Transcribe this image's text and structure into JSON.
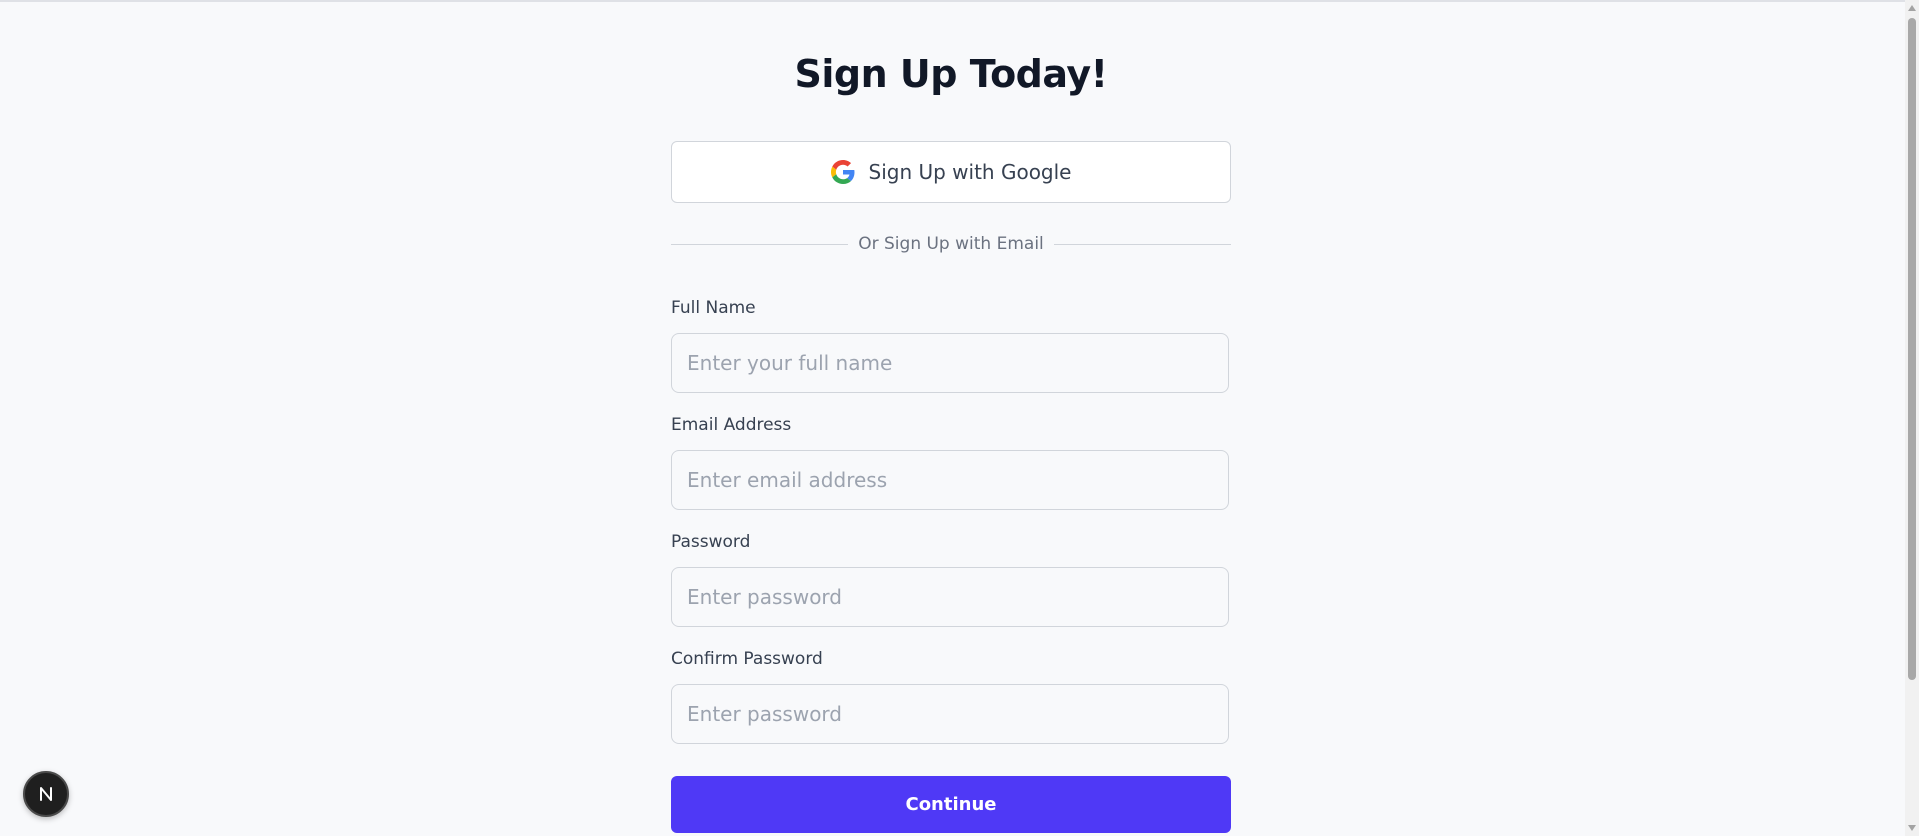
{
  "signup": {
    "title": "Sign Up Today!",
    "google_button_label": "Sign Up with Google",
    "divider_text": "Or Sign Up with Email",
    "fields": {
      "full_name": {
        "label": "Full Name",
        "placeholder": "Enter your full name"
      },
      "email": {
        "label": "Email Address",
        "placeholder": "Enter email address"
      },
      "password": {
        "label": "Password",
        "placeholder": "Enter password"
      },
      "confirm_password": {
        "label": "Confirm Password",
        "placeholder": "Enter password"
      }
    },
    "continue_label": "Continue"
  },
  "badge": {
    "letter": "N"
  },
  "colors": {
    "primary": "#4f39f6",
    "background": "#f8f9fb",
    "heading": "#111827",
    "border": "#d1d5db",
    "placeholder": "#9ca3af"
  },
  "icons": {
    "google": "google-icon",
    "badge": "nextjs-logo-icon"
  }
}
